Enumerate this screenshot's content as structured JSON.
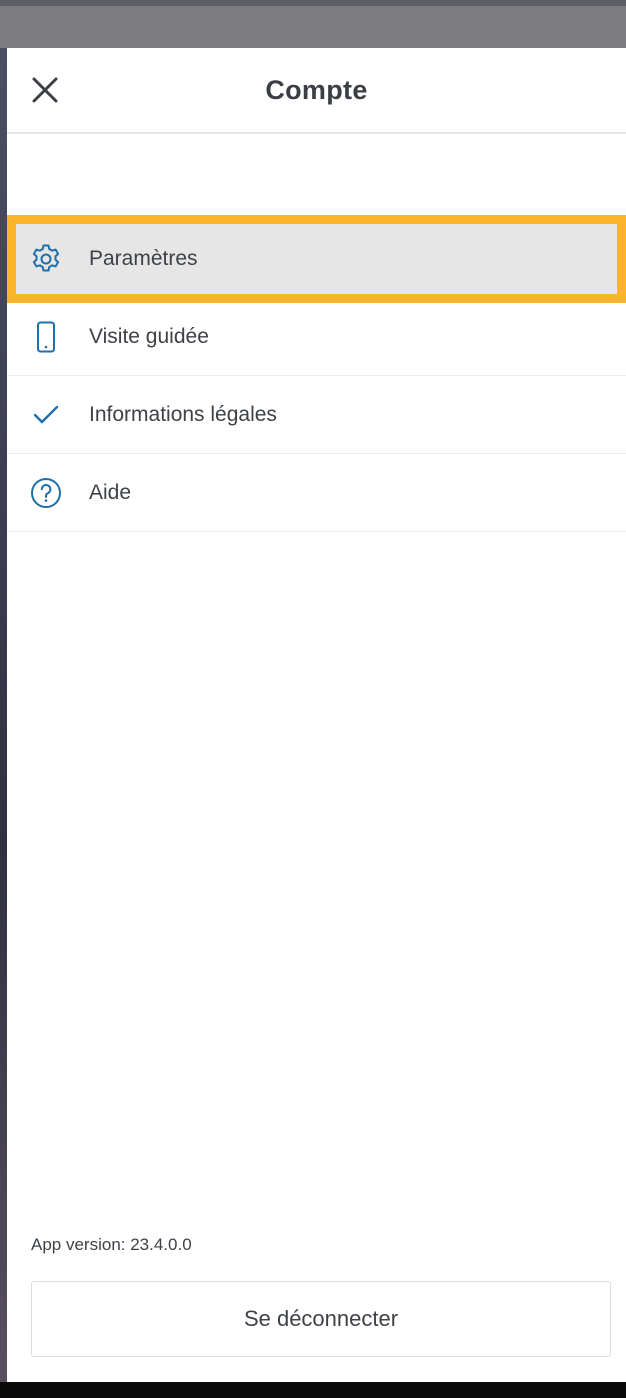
{
  "header": {
    "title": "Compte",
    "close_icon": "close-icon"
  },
  "menu": {
    "items": [
      {
        "label": "Paramètres",
        "icon": "gear-icon",
        "highlighted": true
      },
      {
        "label": "Visite guidée",
        "icon": "phone-icon",
        "highlighted": false
      },
      {
        "label": "Informations légales",
        "icon": "checkmark-icon",
        "highlighted": false
      },
      {
        "label": "Aide",
        "icon": "help-circle-icon",
        "highlighted": false
      }
    ]
  },
  "footer": {
    "version_text": "App version: 23.4.0.0",
    "logout_label": "Se déconnecter"
  },
  "colors": {
    "accent": "#1f6fa8",
    "highlight_border": "#fbb42c",
    "highlight_bg": "#e6e6e6",
    "text": "#3e4247"
  }
}
